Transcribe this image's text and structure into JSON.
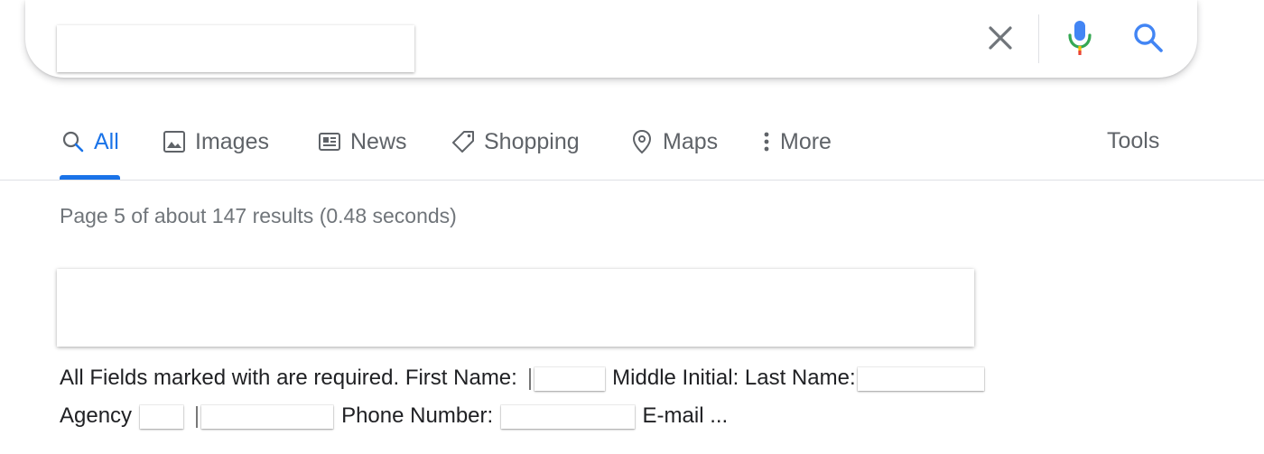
{
  "search": {
    "query": "",
    "clear_icon": "close-icon",
    "mic_icon": "microphone-icon",
    "search_icon": "search-icon"
  },
  "tabs": [
    {
      "label": "All",
      "icon": "search-icon",
      "active": true
    },
    {
      "label": "Images",
      "icon": "image-icon"
    },
    {
      "label": "News",
      "icon": "newspaper-icon"
    },
    {
      "label": "Shopping",
      "icon": "tag-icon"
    },
    {
      "label": "Maps",
      "icon": "map-pin-icon"
    },
    {
      "label": "More",
      "icon": "more-vertical-icon"
    }
  ],
  "tools_label": "Tools",
  "result_stats": "Page 5 of about 147 results (0.48 seconds)",
  "snippet": {
    "part1": "All Fields marked with are required. First Name:",
    "part2": "Middle Initial: Last Name:",
    "part3": "Agency",
    "part4": "Phone Number:",
    "part5": "E-mail ..."
  },
  "colors": {
    "accent": "#1a73e8",
    "tab_text": "#5f6368",
    "stats_text": "#70757a",
    "body_text": "#202124"
  }
}
